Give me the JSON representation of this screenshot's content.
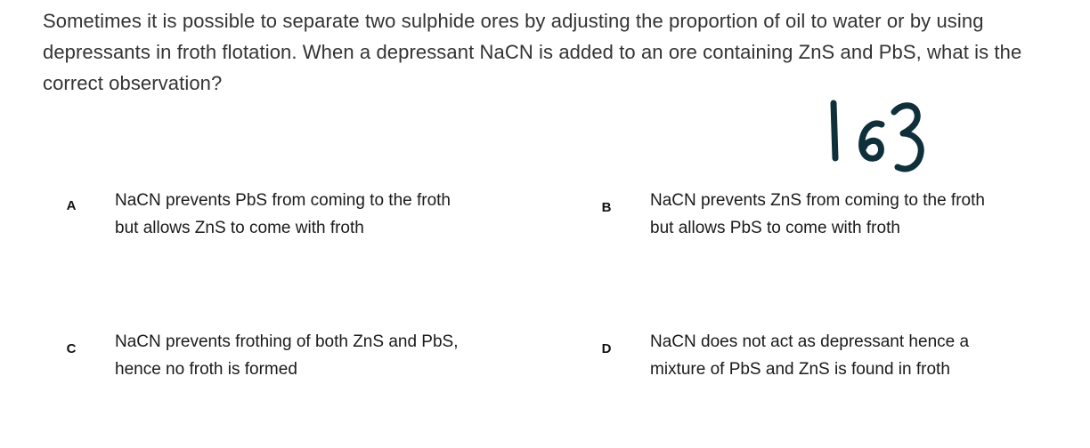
{
  "question": {
    "text": "Sometimes it is possible to separate two sulphide ores by adjusting the proportion of oil to water or by using depressants in froth flotation. When a depressant NaCN is added to an ore containing ZnS and PbS, what is the correct observation?",
    "handwritten_number": "163"
  },
  "options": [
    {
      "letter": "A",
      "line1": "NaCN prevents PbS from coming to the froth",
      "line2": "but allows ZnS to come with froth"
    },
    {
      "letter": "B",
      "line1": "NaCN prevents ZnS from coming to the froth",
      "line2": "but allows PbS to come with froth"
    },
    {
      "letter": "C",
      "line1": "NaCN prevents frothing of both ZnS and PbS,",
      "line2": "hence no froth is formed"
    },
    {
      "letter": "D",
      "line1": "NaCN does not act as depressant hence a",
      "line2": "mixture of PbS and ZnS is found in froth"
    }
  ]
}
